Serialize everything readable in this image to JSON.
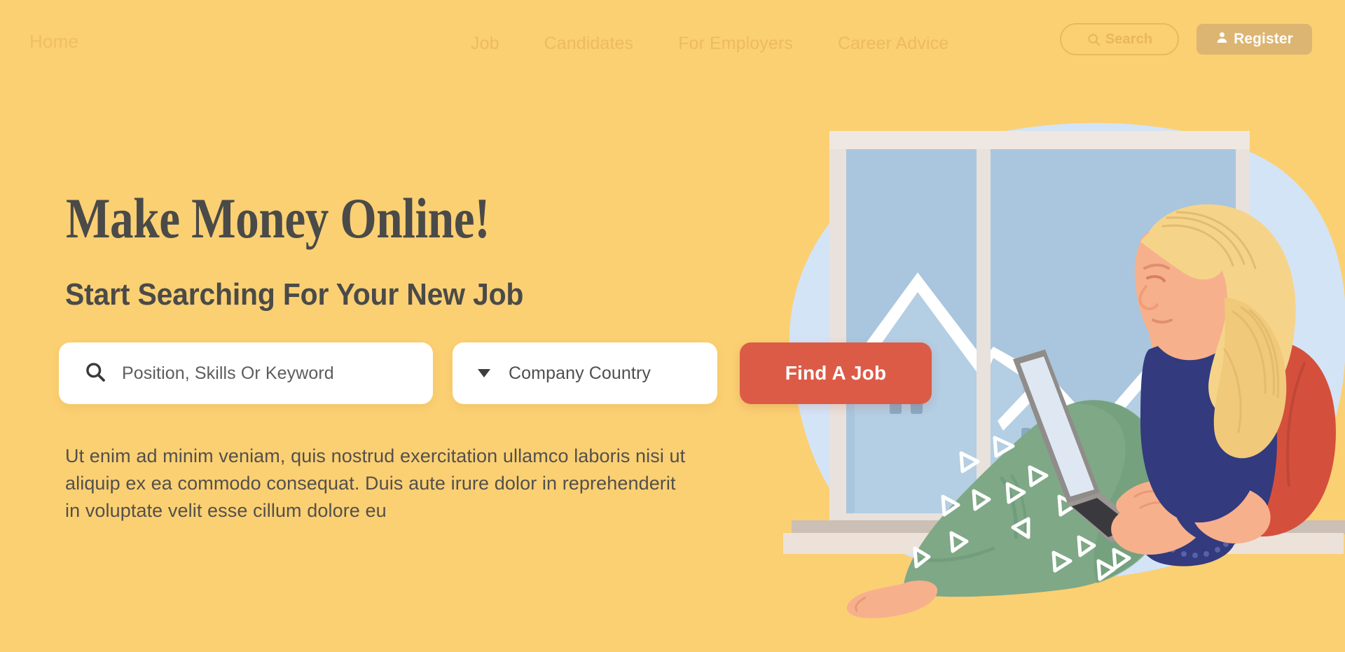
{
  "navbar": {
    "brand": "Home",
    "links": [
      {
        "label": "Job"
      },
      {
        "label": "Candidates"
      },
      {
        "label": "For Employers"
      },
      {
        "label": "Career Advice"
      }
    ],
    "search_button": {
      "label": "Search",
      "icon": "search-icon"
    },
    "register_button": {
      "label": "Register",
      "icon": "user-icon"
    }
  },
  "hero": {
    "headline": "Make Money Online!",
    "subheadline": "Start Searching For Your New Job",
    "keyword_field": {
      "placeholder": "Position, Skills Or Keyword",
      "value": "",
      "icon": "search-icon"
    },
    "country_field": {
      "placeholder": "Company Country",
      "value": "",
      "icon": "caret-down-icon"
    },
    "cta_button": {
      "label": "Find A Job"
    },
    "paragraph": "Ut enim ad minim veniam, quis nostrud exercitation ullamco laboris nisi ut aliquip ex ea commodo consequat. Duis aute irure dolor in reprehenderit in voluptate velit esse cillum dolore eu"
  },
  "illustration": {
    "alt": "Woman sitting on a window sill working on a laptop, snowy houses outside"
  },
  "colors": {
    "background": "#fbd073",
    "nav_text": "#edbb60",
    "register_bg": "#dcb573",
    "heading_text": "#4a4a48",
    "cta_bg": "#dc5b47",
    "cta_text": "#ffffff",
    "field_bg": "#ffffff",
    "field_text": "#5d5d5d",
    "blob_blue": "#d4e4f7",
    "window_frame": "#e8e0da",
    "glass_blue": "#a9c6de",
    "house_blue": "#b4cee3",
    "snow_white": "#ffffff",
    "hair_blond": "#f5d48a",
    "skin": "#f7b08c",
    "shirt_navy": "#333a7d",
    "pants_green": "#7fa886",
    "cushion_red": "#d4503c"
  }
}
